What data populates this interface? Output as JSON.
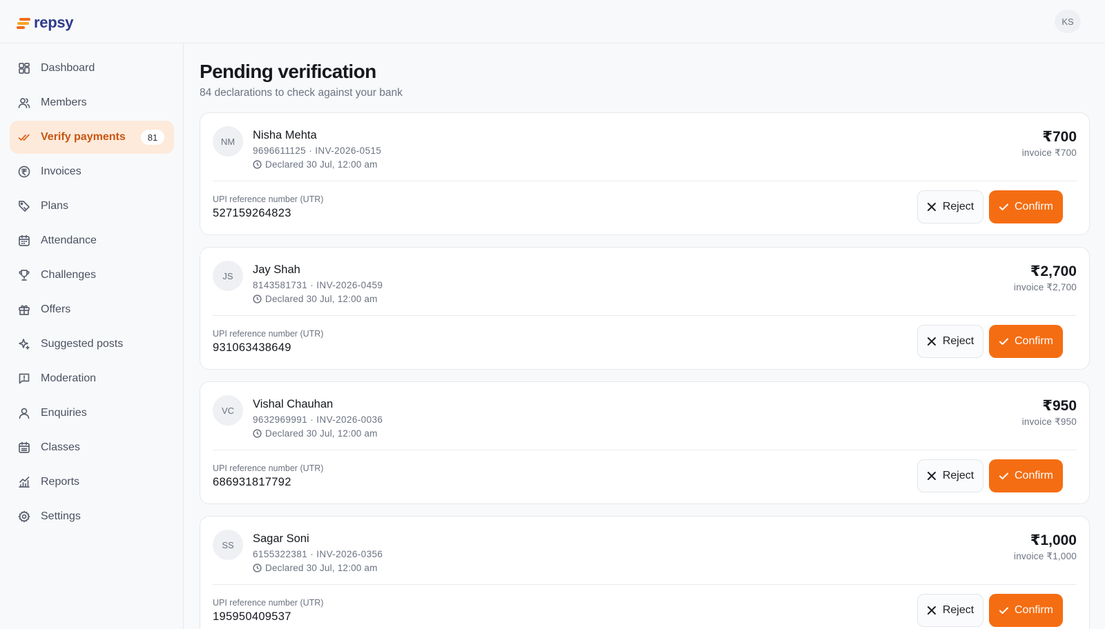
{
  "app": {
    "logo_text": "repsy",
    "user_initials": "KS"
  },
  "sidebar": {
    "items": [
      {
        "label": "Dashboard",
        "icon": "dashboard-icon"
      },
      {
        "label": "Members",
        "icon": "members-icon"
      },
      {
        "label": "Verify payments",
        "icon": "check-double-icon",
        "badge": "81",
        "active": true
      },
      {
        "label": "Invoices",
        "icon": "rupee-coin-icon"
      },
      {
        "label": "Plans",
        "icon": "plans-icon"
      },
      {
        "label": "Attendance",
        "icon": "calendar-icon"
      },
      {
        "label": "Challenges",
        "icon": "trophy-icon"
      },
      {
        "label": "Offers",
        "icon": "gift-icon"
      },
      {
        "label": "Suggested posts",
        "icon": "sparkle-icon"
      },
      {
        "label": "Moderation",
        "icon": "flag-message-icon"
      },
      {
        "label": "Enquiries",
        "icon": "user-icon"
      },
      {
        "label": "Classes",
        "icon": "calendar-grid-icon"
      },
      {
        "label": "Reports",
        "icon": "chart-icon"
      },
      {
        "label": "Settings",
        "icon": "gear-icon"
      }
    ]
  },
  "main": {
    "title": "Pending verification",
    "subtitle": "84 declarations to check against your bank",
    "utr_label": "UPI reference number (UTR)",
    "reject_label": "Reject",
    "confirm_label": "Confirm",
    "cards": [
      {
        "initials": "NM",
        "name": "Nisha Mehta",
        "meta": "9696611125 · INV-2026-0515",
        "declared": "Declared 30 Jul, 12:00 am",
        "amount": "₹700",
        "invoice": "invoice ₹700",
        "utr": "527159264823"
      },
      {
        "initials": "JS",
        "name": "Jay Shah",
        "meta": "8143581731 · INV-2026-0459",
        "declared": "Declared 30 Jul, 12:00 am",
        "amount": "₹2,700",
        "invoice": "invoice ₹2,700",
        "utr": "931063438649"
      },
      {
        "initials": "VC",
        "name": "Vishal Chauhan",
        "meta": "9632969991 · INV-2026-0036",
        "declared": "Declared 30 Jul, 12:00 am",
        "amount": "₹950",
        "invoice": "invoice ₹950",
        "utr": "686931817792"
      },
      {
        "initials": "SS",
        "name": "Sagar Soni",
        "meta": "6155322381 · INV-2026-0356",
        "declared": "Declared 30 Jul, 12:00 am",
        "amount": "₹1,000",
        "invoice": "invoice ₹1,000",
        "utr": "195950409537"
      }
    ]
  },
  "colors": {
    "accent": "#f56d12",
    "active_bg": "#fdeadb",
    "active_text": "#c7550f",
    "brand": "#2d3a8c"
  }
}
